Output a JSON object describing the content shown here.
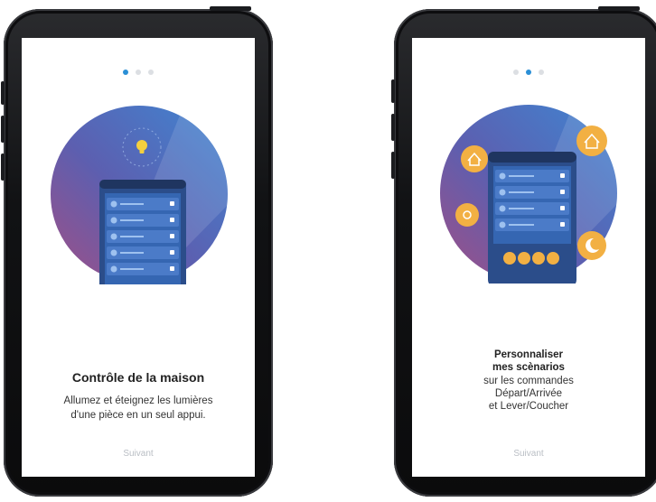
{
  "screens": [
    {
      "pagination": {
        "count": 3,
        "active": 0
      },
      "title": "Contrôle de la maison",
      "description_lines": [
        "Allumez et éteignez les lumières",
        "d'une pièce en un seul appui."
      ],
      "next_label": "Suivant",
      "illustration_icons": [
        "lightbulb-icon"
      ]
    },
    {
      "pagination": {
        "count": 3,
        "active": 1
      },
      "title_lines": [
        "Personnaliser",
        "mes scènarios"
      ],
      "description_lines": [
        "sur les commandes",
        "Départ/Arrivée",
        "et Lever/Coucher"
      ],
      "next_label": "Suivant",
      "illustration_icons": [
        "house-exit-icon",
        "house-arrive-icon",
        "sun-icon",
        "moon-icon"
      ]
    }
  ],
  "colors": {
    "accent_blue": "#2b8fd6",
    "inactive_dot": "#dcdfe3",
    "circle_purple": "#8c4f8f",
    "circle_blue": "#3f79c6",
    "icon_orange": "#f2b043",
    "lightbulb_yellow": "#f4d03f",
    "next_label_gray": "#b9bec4"
  }
}
